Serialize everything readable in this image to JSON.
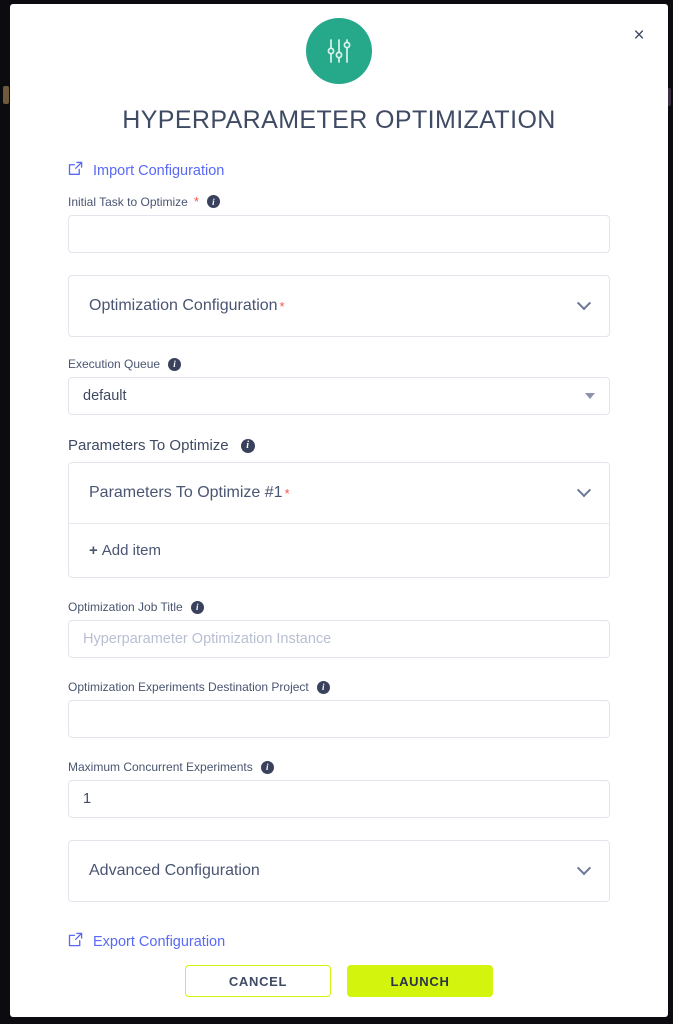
{
  "dialog": {
    "title": "HYPERPARAMETER OPTIMIZATION",
    "close_label": "×",
    "header_icon": "sliders-icon",
    "accent_green": "#26a98a",
    "accent_launch": "#d3f50d",
    "link_color": "#5869f7"
  },
  "import_link": {
    "label": "Import Configuration",
    "icon": "import-arrow-icon"
  },
  "export_link": {
    "label": "Export Configuration",
    "icon": "external-link-icon"
  },
  "fields": {
    "initial_task": {
      "label": "Initial Task to Optimize",
      "required_mark": "*",
      "info_icon": "info-icon",
      "value": "",
      "placeholder": ""
    },
    "optimization_configuration": {
      "label": "Optimization Configuration",
      "required_mark": "*",
      "chevron": "chevron-down-icon"
    },
    "execution_queue": {
      "label": "Execution Queue",
      "info_icon": "info-icon",
      "value": "default",
      "caret": "caret-down-icon"
    },
    "parameters_to_optimize": {
      "label": "Parameters To Optimize",
      "info_icon": "info-icon",
      "item_label": "Parameters To Optimize #1",
      "item_required_mark": "*",
      "add_item_plus": "+",
      "add_item_label": "Add item",
      "chevron": "chevron-down-icon"
    },
    "optimization_job_title": {
      "label": "Optimization Job Title",
      "info_icon": "info-icon",
      "value": "",
      "placeholder": "Hyperparameter Optimization Instance"
    },
    "destination_project": {
      "label": "Optimization Experiments Destination Project",
      "info_icon": "info-icon",
      "value": "",
      "placeholder": ""
    },
    "max_concurrent": {
      "label": "Maximum Concurrent Experiments",
      "info_icon": "info-icon",
      "value": "1",
      "placeholder": ""
    },
    "advanced_configuration": {
      "label": "Advanced Configuration",
      "chevron": "chevron-down-icon"
    }
  },
  "footer": {
    "cancel_label": "CANCEL",
    "launch_label": "LAUNCH"
  },
  "info_glyph": "i"
}
